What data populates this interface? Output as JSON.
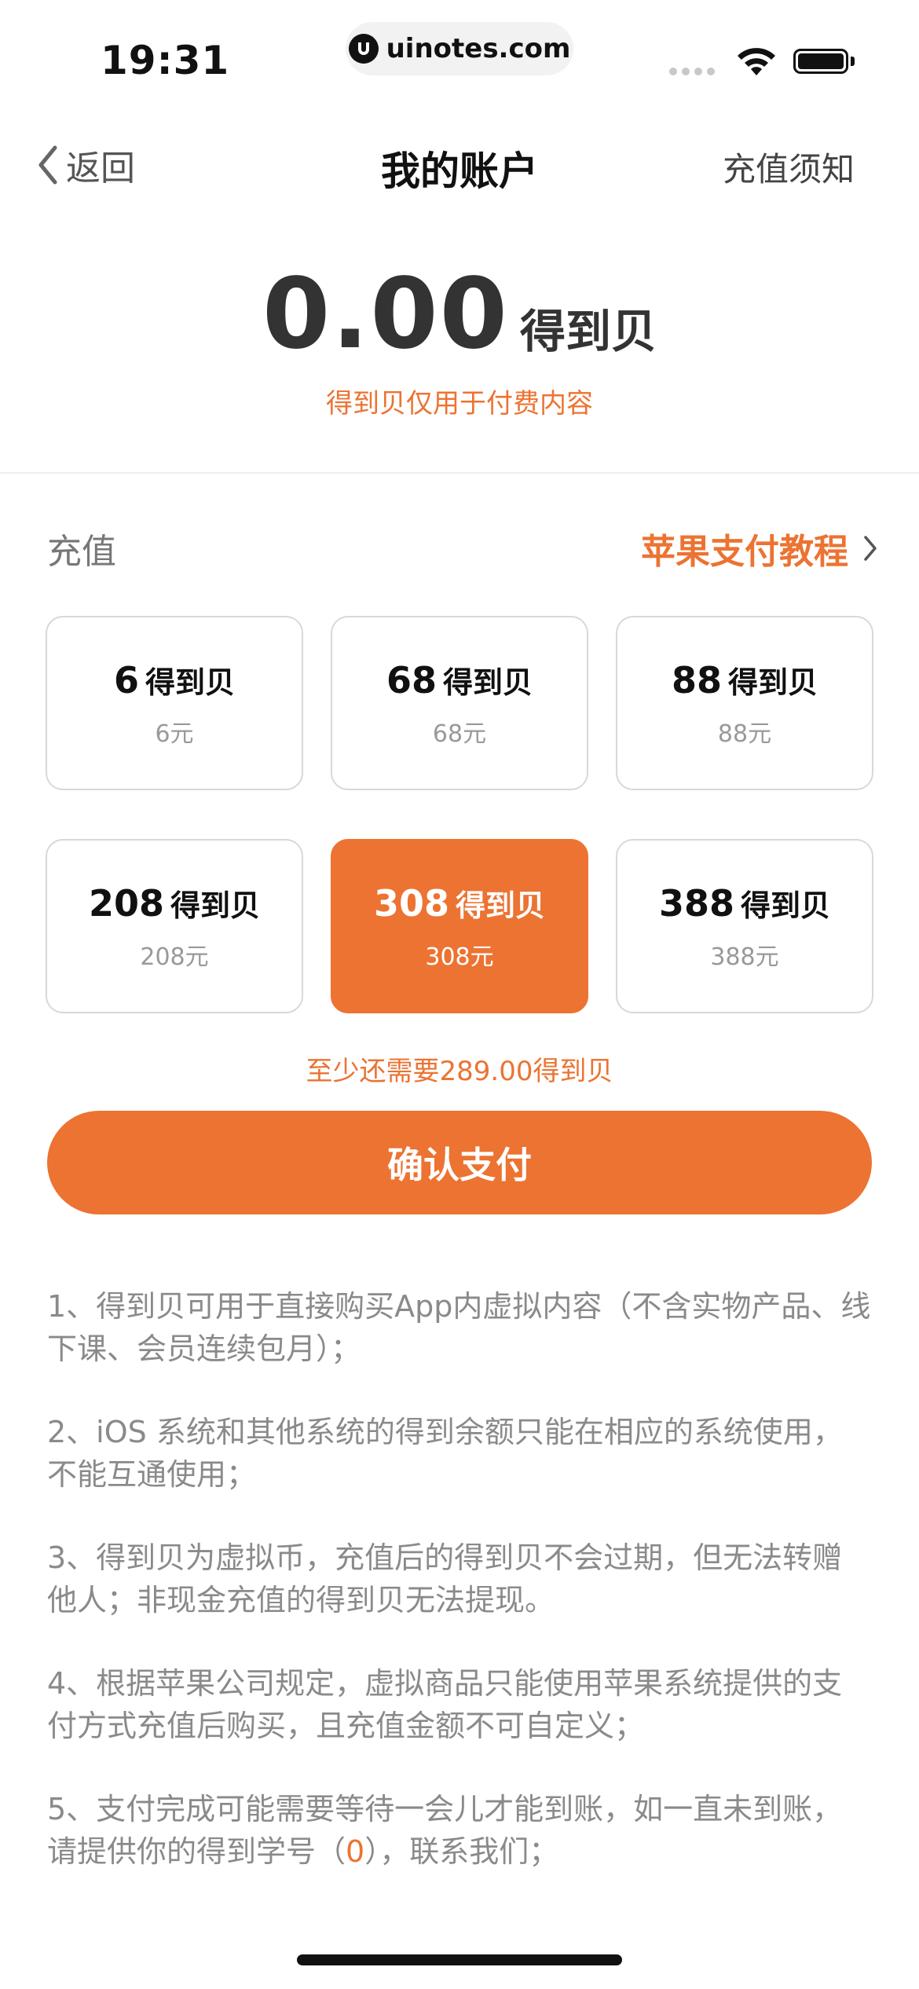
{
  "status_bar": {
    "time": "19:31",
    "url": "uinotes.com"
  },
  "nav": {
    "back_label": "返回",
    "title": "我的账户",
    "right_link": "充值须知"
  },
  "balance": {
    "amount": "0.00",
    "unit": "得到贝",
    "note": "得到贝仅用于付费内容"
  },
  "recharge": {
    "label": "充值",
    "tutorial_link": "苹果支付教程",
    "packages": [
      {
        "amount": "6",
        "unit": "得到贝",
        "price": "6元",
        "selected": false
      },
      {
        "amount": "68",
        "unit": "得到贝",
        "price": "68元",
        "selected": false
      },
      {
        "amount": "88",
        "unit": "得到贝",
        "price": "88元",
        "selected": false
      },
      {
        "amount": "208",
        "unit": "得到贝",
        "price": "208元",
        "selected": false
      },
      {
        "amount": "308",
        "unit": "得到贝",
        "price": "308元",
        "selected": true
      },
      {
        "amount": "388",
        "unit": "得到贝",
        "price": "388元",
        "selected": false
      }
    ],
    "need_more": "至少还需要289.00得到贝",
    "confirm_button": "确认支付"
  },
  "notes": {
    "n1": "1、得到贝可用于直接购买App内虚拟内容（不含实物产品、线下课、会员连续包月）；",
    "n2": "2、iOS 系统和其他系统的得到余额只能在相应的系统使用，不能互通使用；",
    "n3": "3、得到贝为虚拟币，充值后的得到贝不会过期，但无法转赠他人；非现金充值的得到贝无法提现。",
    "n4": "4、根据苹果公司规定，虚拟商品只能使用苹果系统提供的支付方式充值后购买，且充值金额不可自定义；",
    "n5_prefix": "5、支付完成可能需要等待一会儿才能到账，如一直未到账，请提供你的得到学号（",
    "n5_id": "0",
    "n5_suffix": "），联系我们；"
  },
  "colors": {
    "accent": "#ec7332",
    "muted_text": "#8a8a8a",
    "border": "#d8d8d8"
  }
}
